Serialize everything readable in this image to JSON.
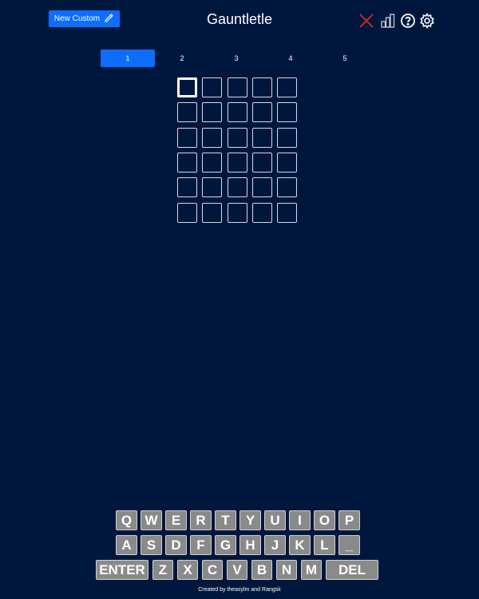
{
  "header": {
    "new_custom_label": "New Custom",
    "title": "Gauntletle",
    "icons": [
      "close-icon",
      "stats-icon",
      "help-icon",
      "settings-icon"
    ]
  },
  "tabs": [
    "1",
    "2",
    "3",
    "4",
    "5"
  ],
  "active_tab": "1",
  "board": {
    "rows": 6,
    "cols": 5
  },
  "keyboard": {
    "row1": [
      "Q",
      "W",
      "E",
      "R",
      "T",
      "Y",
      "U",
      "I",
      "O",
      "P"
    ],
    "row2": [
      "A",
      "S",
      "D",
      "F",
      "G",
      "H",
      "J",
      "K",
      "L",
      "_"
    ],
    "row3": [
      "ENTER",
      "Z",
      "X",
      "C",
      "V",
      "B",
      "N",
      "M",
      "DEL"
    ]
  },
  "footer": "Created by theasylm and Rangsk",
  "colors": {
    "background": "#00173d",
    "accent": "#0d6efd",
    "close_icon": "#c0262c",
    "key_bg": "#8a8a8a"
  }
}
